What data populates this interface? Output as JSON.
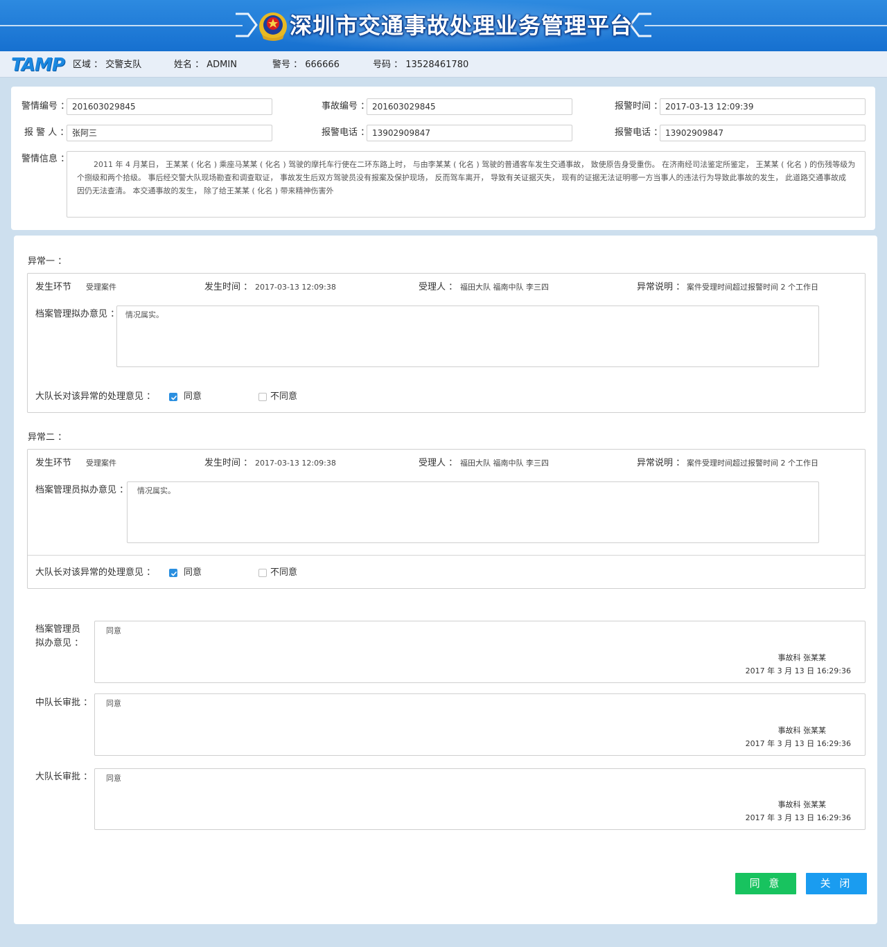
{
  "header": {
    "title": "深圳市交通事故处理业务管理平台",
    "logo": "TAMP",
    "region": "区域 ： 交警支队",
    "name": "姓名 ： ADMIN",
    "badge": "警号 ： 666666",
    "phone": "号码 ： 13528461780"
  },
  "alarm": {
    "alarm_no_label": "警情编号 ：",
    "alarm_no": "201603029845",
    "accident_no_label": "事故编号 ：",
    "accident_no": "201603029845",
    "report_time_label": "报警时间 ：",
    "report_time": "2017-03-13  12:09:39",
    "reporter_label": "报 警 人 ：",
    "reporter": "张阿三",
    "report_phone_label": "报警电话 ：",
    "report_phone": "13902909847",
    "report_phone2_label": "报警电话 ：",
    "report_phone2": "13902909847",
    "info_label": "警情信息 ：",
    "info_line1": "2011 年 4 月某日， 王某某 ( 化名 ) 乘座马某某 ( 化名 ) 驾驶的摩托车行使在二环东路上时， 与由李某某 ( 化名 ) 驾驶的普通客车发生交通事故， 致使原告身受重伤。 在济南经司法鉴定所鉴定， 王某某 ( 化名 ) 的伤残等级为一",
    "info_line2": "个捌级和两个拾级。 事后经交警大队现场勘查和调查取证， 事故发生后双方驾驶员没有报案及保护现场， 反而驾车离开， 导致有关证据灭失， 现有的证据无法证明哪一方当事人的违法行为导致此事故的发生， 此道路交通事故成",
    "info_line3": "因仍无法查清。 本交通事故的发生， 除了给王某某 ( 化名 ) 带来精神伤害外"
  },
  "exceptions": [
    {
      "title": "异常一 ：",
      "stage_label": "发生环节",
      "stage": "受理案件",
      "time_label": "发生时间 ：",
      "time": "2017-03-13  12:09:38",
      "handler_label": "受理人 ：",
      "handler": "福田大队  福南中队  李三四",
      "desc_label": "异常说明 ：",
      "desc": "案件受理时间超过报警时间 2 个工作日",
      "opinion_label": "档案管理拟办意见 ：",
      "opinion": "情况属实。",
      "leader_label": "大队长对该异常的处理意见 ：",
      "agree": "同意",
      "disagree": "不同意"
    },
    {
      "title": "异常二 ：",
      "stage_label": "发生环节",
      "stage": "受理案件",
      "time_label": "发生时间 ：",
      "time": "2017-03-13  12:09:38",
      "handler_label": "受理人 ：",
      "handler": "福田大队  福南中队  李三四",
      "desc_label": "异常说明 ：",
      "desc": "案件受理时间超过报警时间 2 个工作日",
      "opinion_label": "档案管理员拟办意见 ：",
      "opinion": "情况属实。",
      "leader_label": "大队长对该异常的处理意见 ：",
      "agree": "同意",
      "disagree": "不同意"
    }
  ],
  "approvals": [
    {
      "label_line1": "档案管理员",
      "label_line2": "拟办意见 ：",
      "text": "同意",
      "dept": "事故科 张某某",
      "date": "2017 年 3 月 13 日 16:29:36"
    },
    {
      "label_line1": "中队长审批 ：",
      "label_line2": "",
      "text": "同意",
      "dept": "事故科 张某某",
      "date": "2017 年 3 月 13 日 16:29:36"
    },
    {
      "label_line1": "大队长审批 ：",
      "label_line2": "",
      "text": "同意",
      "dept": "事故科 张某某",
      "date": "2017 年 3 月 13 日 16:29:36"
    }
  ],
  "buttons": {
    "agree": "同 意",
    "close": "关 闭"
  },
  "colors": {
    "banner": "#1670d0",
    "agree_button": "#18c35f",
    "close_button": "#1a9cf0",
    "checkbox": "#2a8fe0"
  }
}
